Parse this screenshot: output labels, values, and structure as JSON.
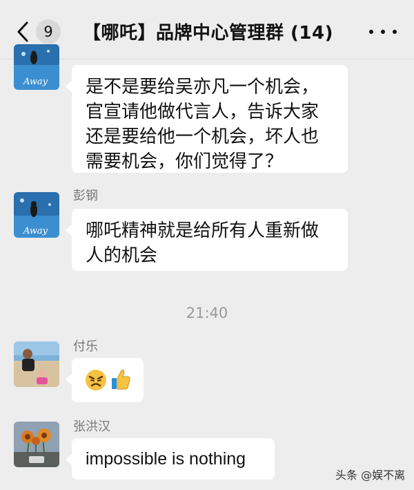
{
  "header": {
    "unread_count": "9",
    "title": "【哪吒】品牌中心管理群 (14)"
  },
  "messages": [
    {
      "sender": "",
      "avatar_icon": "away-avatar-icon",
      "lines": [
        "是不是要给吴亦凡一个机会，",
        "官宣请他做代言人，告诉大家",
        "还是要给他一个机会，坏人也",
        "需要机会，你们觉得了？"
      ]
    },
    {
      "sender": "彭钢",
      "avatar_icon": "away-avatar-icon",
      "lines": [
        "哪吒精神就是给所有人重新做",
        "人的机会"
      ]
    },
    {
      "sender": "付乐",
      "avatar_icon": "beach-photo-avatar-icon",
      "emoji": [
        "angry-face-emoji",
        "thumbs-up-emoji"
      ]
    },
    {
      "sender": "张洪汉",
      "avatar_icon": "flowers-photo-avatar-icon",
      "lines": [
        "impossible is nothing"
      ]
    }
  ],
  "timestamp": "21:40",
  "watermark": "头条 @娱不离",
  "colors": {
    "background": "#ededed",
    "bubble": "#ffffff",
    "sender_text": "#777777",
    "timestamp_text": "#9a9a9a"
  }
}
